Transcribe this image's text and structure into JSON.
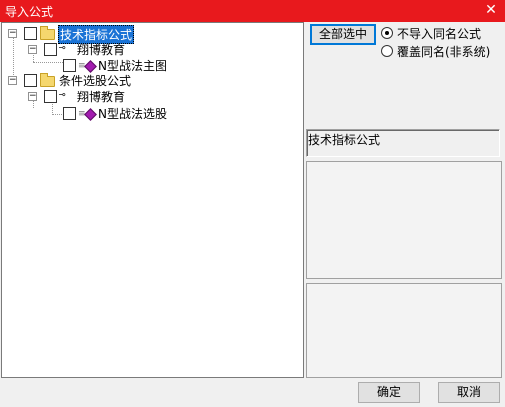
{
  "window": {
    "title": "导入公式",
    "close_glyph": "✕"
  },
  "tree": {
    "nodes": [
      {
        "label": "技术指标公式",
        "selected": true
      },
      {
        "label": "翔博教育"
      },
      {
        "label": "N型战法主图"
      },
      {
        "label": "条件选股公式"
      },
      {
        "label": "翔博教育"
      },
      {
        "label": "N型战法选股"
      }
    ],
    "expander_glyph": "−"
  },
  "options": {
    "select_all_label": "全部选中",
    "radio_no_import_label": "不导入同名公式",
    "radio_overwrite_label": "覆盖同名(非系统)",
    "selected_radio": "no_import"
  },
  "info": {
    "formula_type": "技术指标公式"
  },
  "footer": {
    "ok_label": "确定",
    "cancel_label": "取消"
  }
}
